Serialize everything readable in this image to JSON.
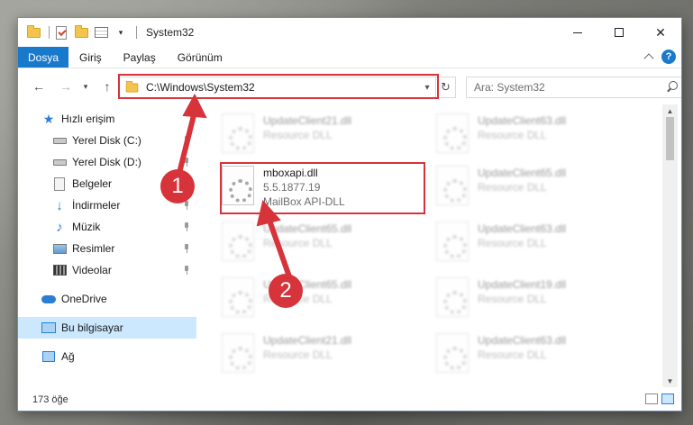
{
  "window": {
    "title": "System32",
    "controls": {
      "minimize": "minimize",
      "maximize": "maximize",
      "close": "✕"
    }
  },
  "ribbon": {
    "file_tab": "Dosya",
    "tabs": [
      "Giriş",
      "Paylaş",
      "Görünüm"
    ],
    "help": "?"
  },
  "address": {
    "path": "C:\\Windows\\System32",
    "search_placeholder": "Ara: System32"
  },
  "nav": {
    "quick_access": "Hızlı erişim",
    "items": [
      {
        "label": "Yerel Disk (C:)",
        "icon": "drive-icon",
        "pinned": true
      },
      {
        "label": "Yerel Disk (D:)",
        "icon": "drive-icon",
        "pinned": true
      },
      {
        "label": "Belgeler",
        "icon": "documents-icon",
        "pinned": true
      },
      {
        "label": "İndirmeler",
        "icon": "downloads-icon",
        "pinned": true
      },
      {
        "label": "Müzik",
        "icon": "music-icon",
        "pinned": true
      },
      {
        "label": "Resimler",
        "icon": "pictures-icon",
        "pinned": true
      },
      {
        "label": "Videolar",
        "icon": "videos-icon",
        "pinned": true
      }
    ],
    "onedrive": "OneDrive",
    "this_pc": "Bu bilgisayar",
    "network": "Ağ"
  },
  "files": [
    {
      "name": "UpdateClient21.dll",
      "desc": "Resource DLL",
      "blurred": true
    },
    {
      "name": "UpdateClient63.dll",
      "desc": "Resource DLL",
      "blurred": true
    },
    {
      "name": "mboxapi.dll",
      "version": "5.5.1877.19",
      "desc": "MailBox API-DLL",
      "blurred": false
    },
    {
      "name": "UpdateClient65.dll",
      "desc": "Resource DLL",
      "blurred": true
    },
    {
      "name": "UpdateClient65.dll",
      "desc": "Resource DLL",
      "blurred": true
    },
    {
      "name": "UpdateClient63.dll",
      "desc": "Resource DLL",
      "blurred": true
    },
    {
      "name": "UpdateClient65.dll",
      "desc": "Resource DLL",
      "blurred": true
    },
    {
      "name": "UpdateClient19.dll",
      "desc": "Resource DLL",
      "blurred": true
    },
    {
      "name": "UpdateClient21.dll",
      "desc": "Resource DLL",
      "blurred": true
    },
    {
      "name": "UpdateClient63.dll",
      "desc": "Resource DLL",
      "blurred": true
    }
  ],
  "status": {
    "count": "173 öğe"
  },
  "annotations": {
    "step1": "1",
    "step2": "2",
    "color": "#d6333a"
  }
}
